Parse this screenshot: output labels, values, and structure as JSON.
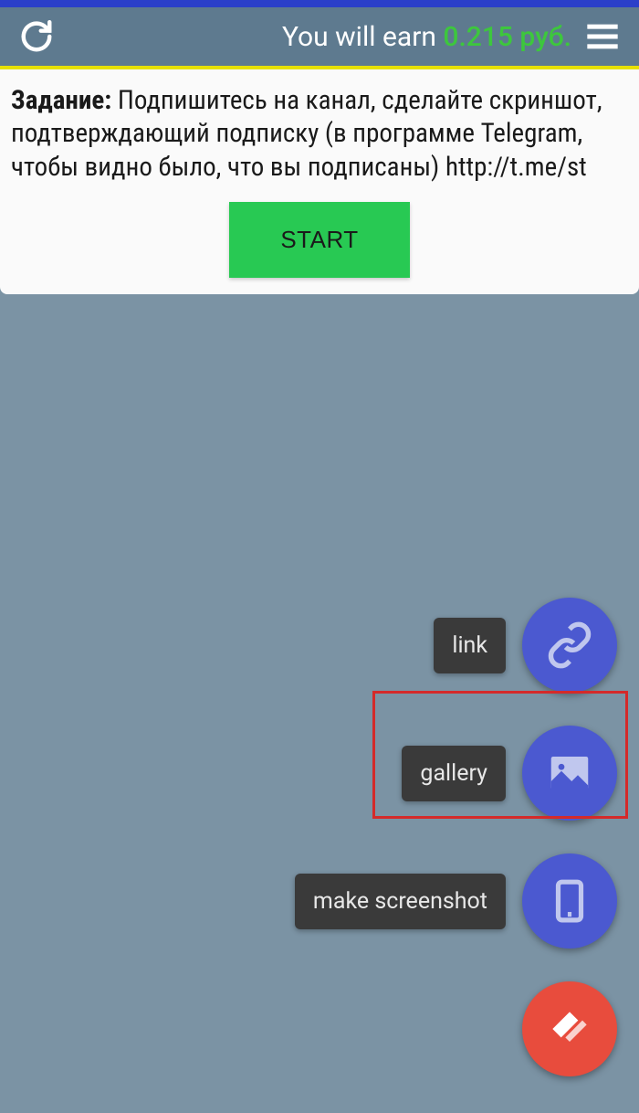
{
  "header": {
    "earn_prefix": "You will earn ",
    "earn_amount": "0.215 руб."
  },
  "task": {
    "label": "Задание:",
    "text": " Подпишитесь на канал, сделайте скриншот, подтверждающий подписку (в программе Telegram, чтобы видно было, что вы подписаны) http://t.me/st",
    "start_button": "START"
  },
  "fabs": {
    "link_label": "link",
    "gallery_label": "gallery",
    "screenshot_label": "make screenshot"
  }
}
